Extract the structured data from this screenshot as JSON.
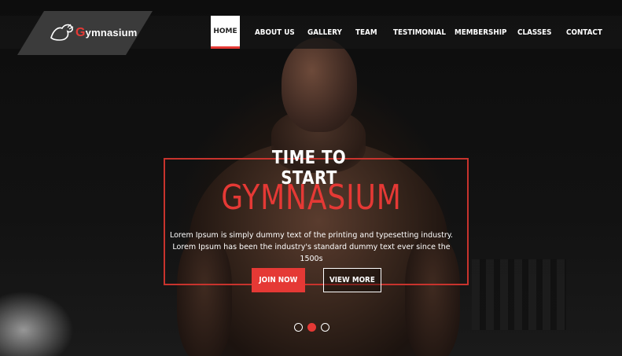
{
  "brand": {
    "logo_text_first": "G",
    "logo_text_rest": "ymnasium",
    "accent_color": "#e53935"
  },
  "nav": {
    "items": [
      {
        "label": "HOME",
        "active": true
      },
      {
        "label": "ABOUT US"
      },
      {
        "label": "GALLERY"
      },
      {
        "label": "TEAM"
      },
      {
        "label": "TESTIMONIAL"
      },
      {
        "label": "MEMBERSHIP"
      },
      {
        "label": "CLASSES"
      },
      {
        "label": "CONTACT"
      }
    ]
  },
  "hero": {
    "pre_title": "TIME TO START",
    "title": "GYMNASIUM",
    "description": "Lorem Ipsum is simply dummy text of the printing and typesetting industry. Lorem Ipsum has been the industry's standard dummy text ever since the 1500s",
    "join_label": "JOIN NOW",
    "view_label": "VIEW MORE"
  },
  "slider": {
    "count": 3,
    "active_index": 1
  }
}
